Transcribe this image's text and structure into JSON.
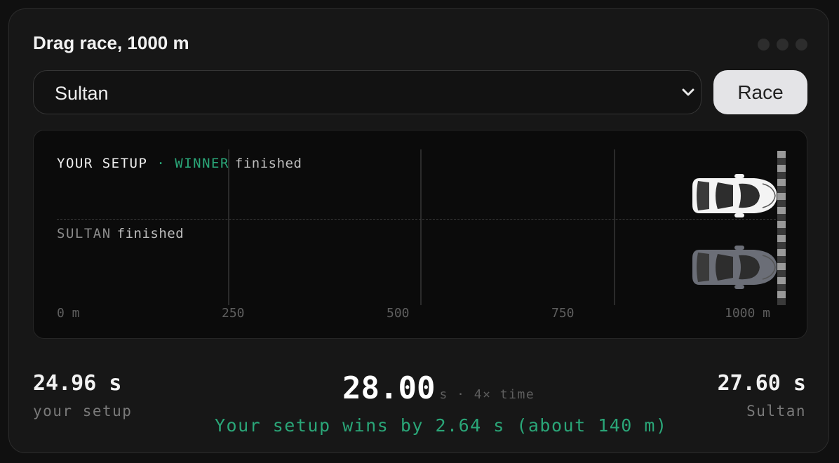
{
  "title": "Drag race, 1000 m",
  "selector": {
    "value": "Sultan"
  },
  "race_button": {
    "label": "Race"
  },
  "track": {
    "ticks": [
      "0 m",
      "250",
      "500",
      "750",
      "1000 m"
    ],
    "lanes": [
      {
        "name": "YOUR SETUP",
        "separator": "·",
        "badge": "WINNER",
        "status": "finished",
        "car_color": "#f4f4f4",
        "progress": 1.0
      },
      {
        "name": "SULTAN",
        "status": "finished",
        "car_color": "#6b6e77",
        "progress": 1.0
      }
    ]
  },
  "results": {
    "left": {
      "value": "24.96 s",
      "label": "your setup"
    },
    "right": {
      "value": "27.60 s",
      "label": "Sultan"
    },
    "clock": {
      "value": "28.00",
      "unit": "s · 4× time"
    },
    "verdict": "Your setup wins by 2.64 s (about 140 m)"
  },
  "colors": {
    "accent": "#2aa678",
    "background": "#171717",
    "track": "#0b0b0b",
    "button": "#e4e4e7"
  },
  "icons": {
    "chevron": "chevron-down-icon",
    "menu": "more-dots-icon"
  }
}
